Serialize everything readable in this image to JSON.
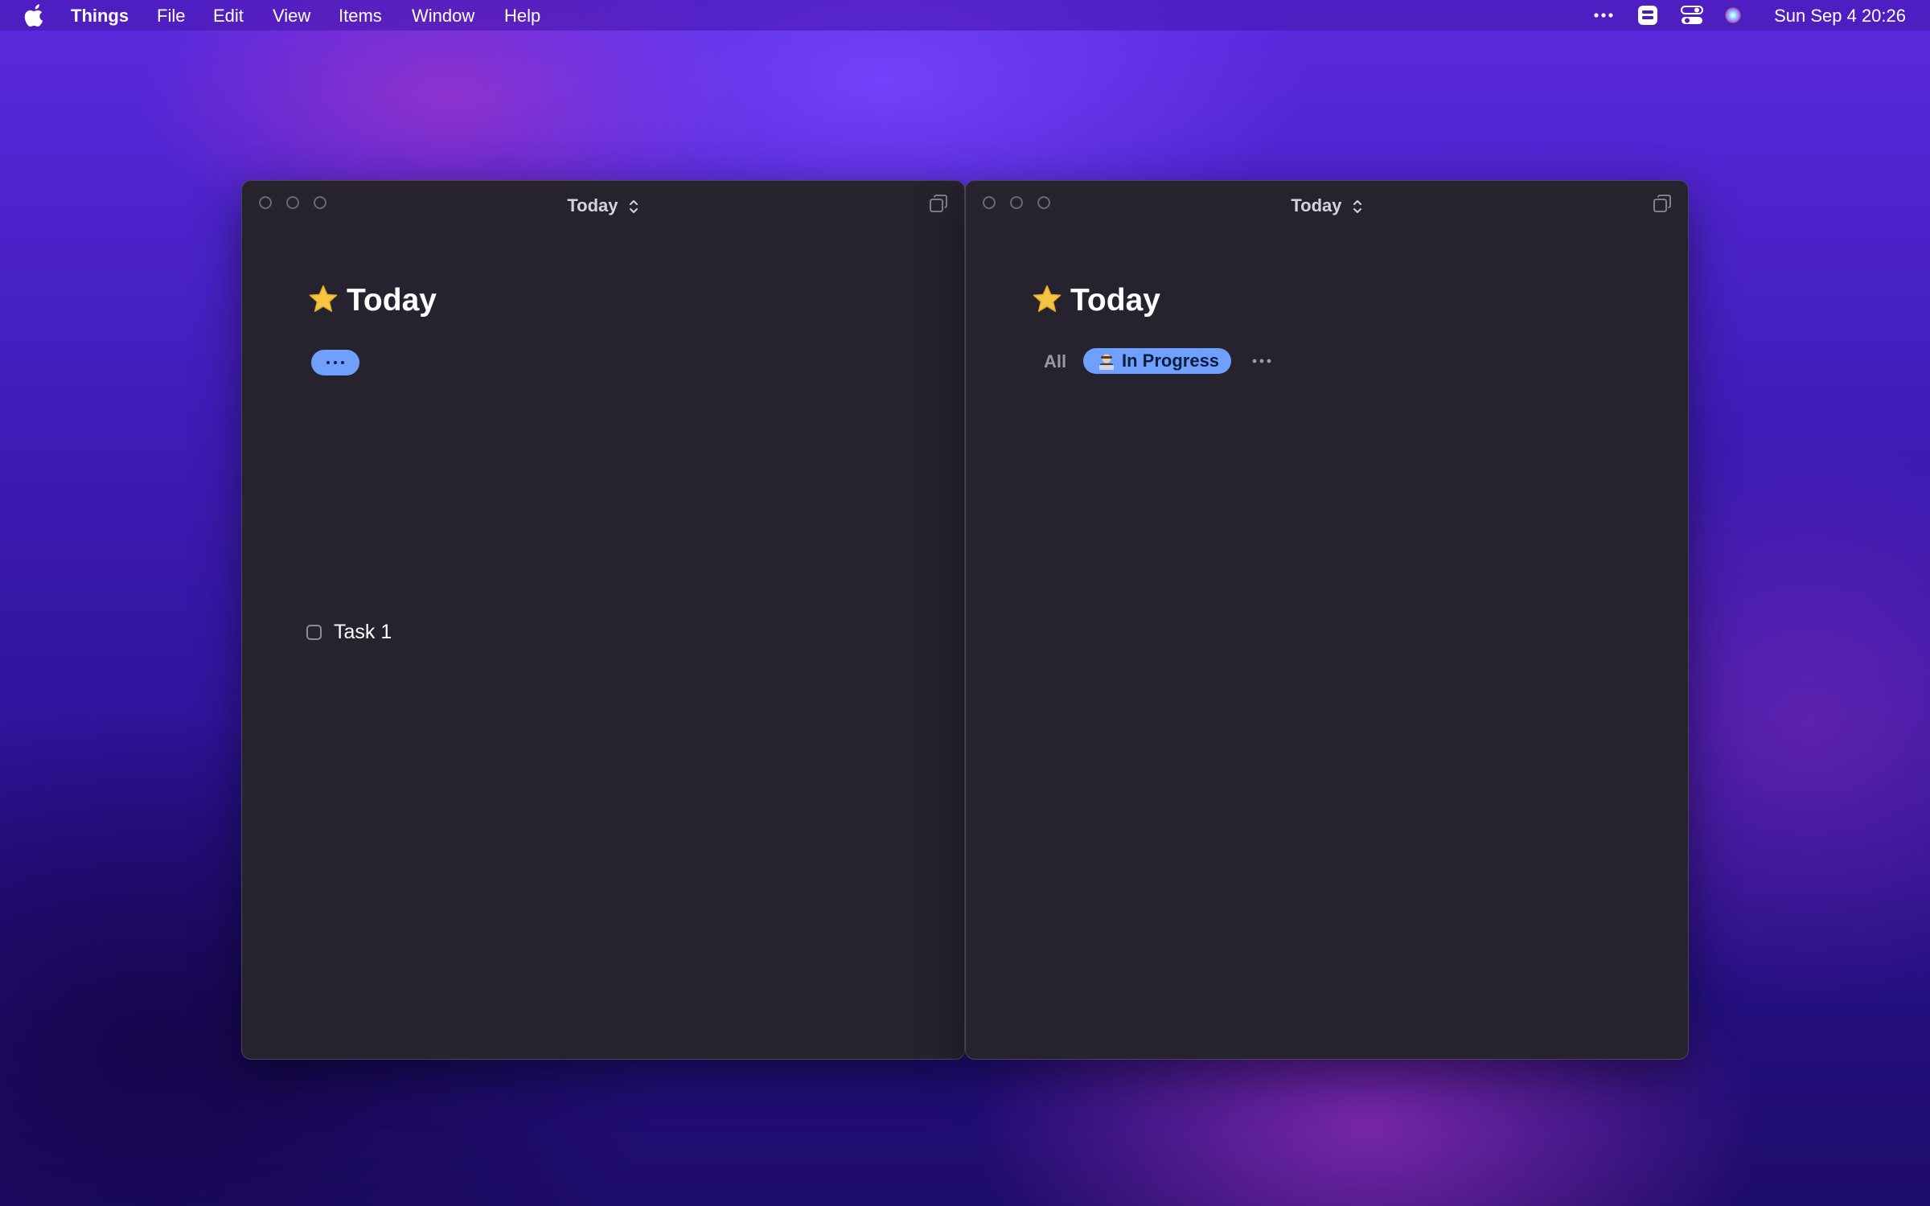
{
  "menubar": {
    "app_name": "Things",
    "menus": [
      "File",
      "Edit",
      "View",
      "Items",
      "Window",
      "Help"
    ],
    "status_icons": [
      "more-icon",
      "stage-manager-icon",
      "control-center-icon",
      "siri-icon"
    ],
    "datetime": "Sun Sep 4  20:26"
  },
  "left_window": {
    "title": "Today",
    "heading": "Today",
    "heading_icon": "star-icon",
    "tag_filter_icon": "ellipsis-icon",
    "tasks": [
      {
        "title": "Task 1",
        "checked": false
      }
    ]
  },
  "right_window": {
    "title": "Today",
    "heading": "Today",
    "heading_icon": "star-icon",
    "filters": {
      "all_label": "All",
      "active_label": "In Progress",
      "active_icon": "technologist-emoji-icon",
      "more_icon": "ellipsis-icon"
    }
  },
  "colors": {
    "window_bg": "#26232f",
    "accent_pill": "#6fa0ff",
    "star": "#f5c542",
    "menubar_text": "#ffffff"
  }
}
